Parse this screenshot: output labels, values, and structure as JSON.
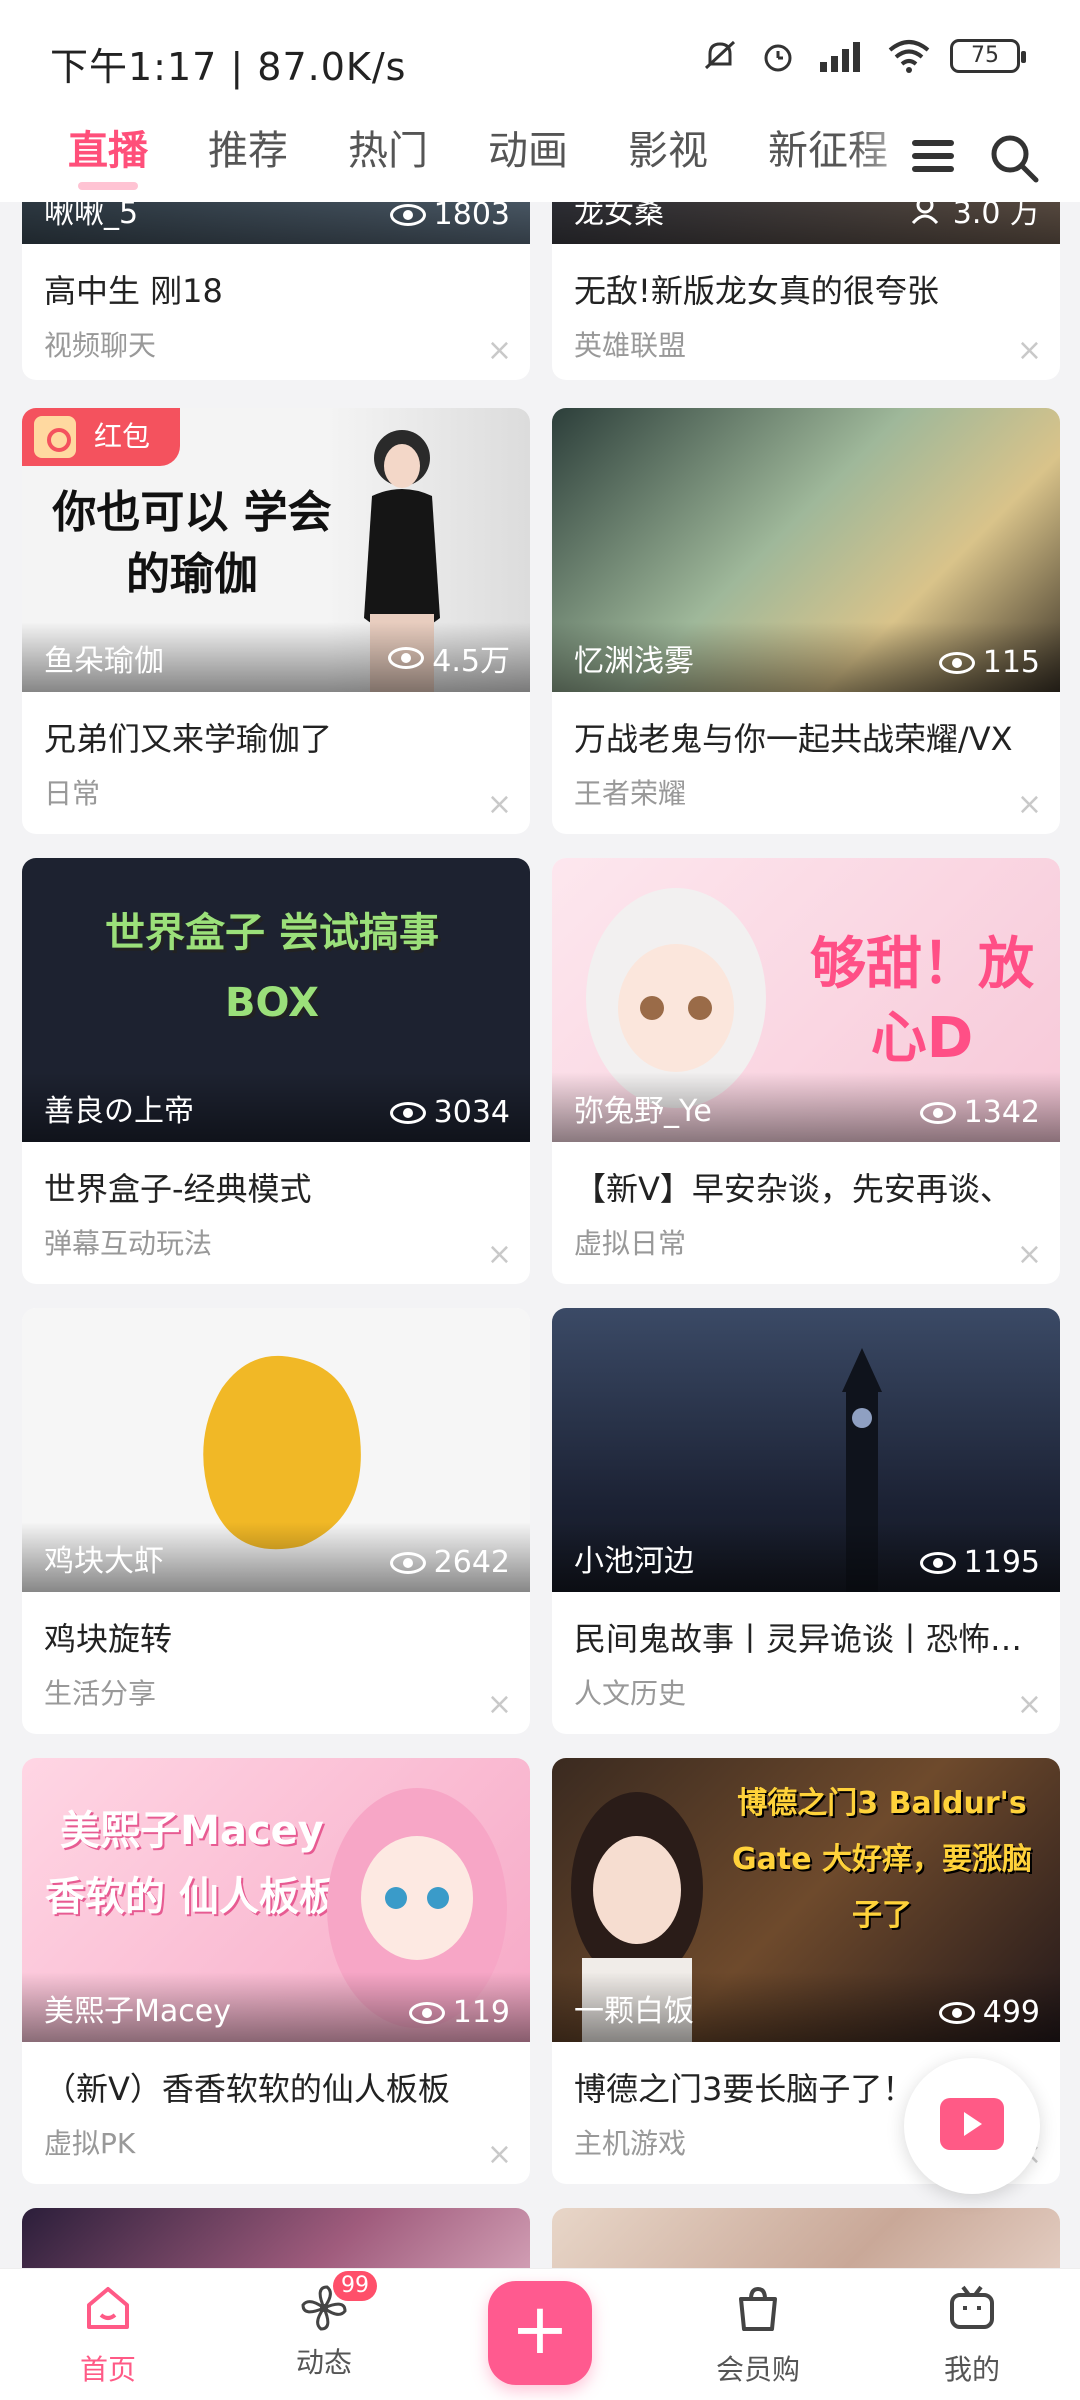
{
  "status_bar": {
    "time_speed": "下午1:17 | 87.0K/s",
    "battery": "75"
  },
  "tabs": [
    "直播",
    "推荐",
    "热门",
    "动画",
    "影视",
    "新征程"
  ],
  "cards": [
    {
      "streamer": "啾啾_5",
      "views": "1803",
      "title": "高中生 刚18",
      "category": "视频聊天"
    },
    {
      "streamer": "龙女桑",
      "views": "3.0 万",
      "title": "无敌!新版龙女真的很夸张",
      "category": "英雄联盟"
    },
    {
      "streamer": "鱼朵瑜伽",
      "views": "4.5万",
      "title": "兄弟们又来学瑜伽了",
      "category": "日常",
      "tag": "红包",
      "thumb_text": "你也可以 学会的瑜伽"
    },
    {
      "streamer": "忆渊浅雾",
      "views": "115",
      "title": "万战老鬼与你一起共战荣耀/VX",
      "category": "王者荣耀"
    },
    {
      "streamer": "善良の上帝",
      "views": "3034",
      "title": "世界盒子-经典模式",
      "category": "弹幕互动玩法",
      "thumb_text": "世界盒子 尝试搞事 BOX"
    },
    {
      "streamer": "弥兔野_Ye",
      "views": "1342",
      "title": "【新V】早安杂谈，先安再谈、",
      "category": "虚拟日常",
      "thumb_text": "够甜！放心D"
    },
    {
      "streamer": "鸡块大虾",
      "views": "2642",
      "title": "鸡块旋转",
      "category": "生活分享"
    },
    {
      "streamer": "小池河边",
      "views": "1195",
      "title": "民间鬼故事丨灵异诡谈丨恐怖…",
      "category": "人文历史"
    },
    {
      "streamer": "美熙子Macey",
      "views": "119",
      "title": "（新V）香香软软的仙人板板",
      "category": "虚拟PK",
      "thumb_text": "美熙子Macey 香软的 仙人板板"
    },
    {
      "streamer": "一颗白饭",
      "views": "499",
      "title": "博德之门3要长脑子了！",
      "category": "主机游戏",
      "thumb_text": "博德之门3 Baldur's Gate 大好痒，要涨脑子了"
    }
  ],
  "bottom_nav": {
    "home": "首页",
    "dynamic": "动态",
    "dynamic_badge": "99",
    "plus": "+",
    "shop": "会员购",
    "mine": "我的"
  }
}
